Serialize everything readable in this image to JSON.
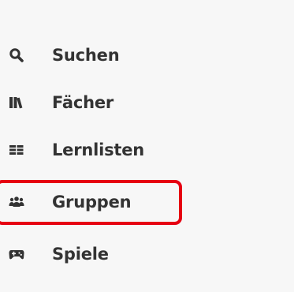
{
  "nav": {
    "items": [
      {
        "label": "Suchen",
        "icon": "search-icon"
      },
      {
        "label": "Fächer",
        "icon": "books-icon"
      },
      {
        "label": "Lernlisten",
        "icon": "list-icon"
      },
      {
        "label": "Gruppen",
        "icon": "users-icon"
      },
      {
        "label": "Spiele",
        "icon": "gamepad-icon"
      }
    ]
  },
  "colors": {
    "background": "#f7f7f7",
    "text": "#333333",
    "highlight": "#e60012"
  }
}
